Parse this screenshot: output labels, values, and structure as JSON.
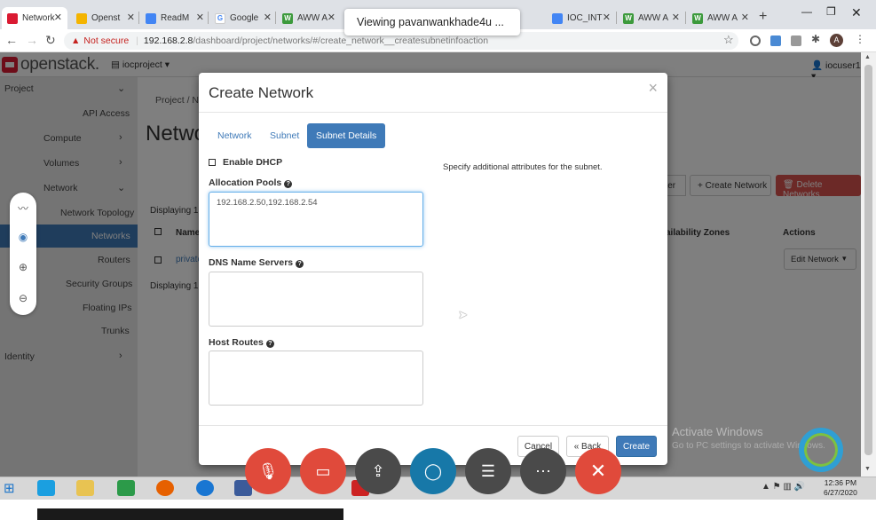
{
  "browser": {
    "tabs": [
      {
        "label": "Network",
        "icon": "openstack-favicon-icon",
        "color": "#da1a32",
        "active": true
      },
      {
        "label": "Openst",
        "icon": "drive-favicon-icon",
        "color": "#f4b400"
      },
      {
        "label": "ReadM",
        "icon": "docs-favicon-icon",
        "color": "#4285f4"
      },
      {
        "label": "Google",
        "icon": "google-favicon-icon",
        "color": "#4285f4"
      },
      {
        "label": "AWW A",
        "icon": "w-favicon-icon",
        "color": "#3c9a3c"
      },
      {
        "label": "IOC_INT",
        "icon": "docs-favicon-icon",
        "color": "#4285f4"
      },
      {
        "label": "AWW A",
        "icon": "w-favicon-icon",
        "color": "#3c9a3c"
      },
      {
        "label": "AWW A",
        "icon": "w-favicon-icon",
        "color": "#3c9a3c"
      }
    ],
    "address": {
      "warning": "Not secure",
      "host": "192.168.2.8",
      "path": "/dashboard/project/networks/#/create_network__createsubnetinfoaction"
    },
    "viewing_banner": "Viewing pavanwankhade4u ...",
    "profile_initial": "A"
  },
  "header": {
    "logo_text": "openstack.",
    "project": "iocproject",
    "user": "iocuser1"
  },
  "sidebar": {
    "project": "Project",
    "api_access": "API Access",
    "compute": "Compute",
    "volumes": "Volumes",
    "network": "Network",
    "network_topology": "Network Topology",
    "networks": "Networks",
    "routers": "Routers",
    "security_groups": "Security Groups",
    "floating_ips": "Floating IPs",
    "trunks": "Trunks",
    "identity": "Identity"
  },
  "page": {
    "breadcrumb": "Project / N",
    "title": "Netwo",
    "filter_btn": "ilter",
    "create_network_btn": "+ Create Network",
    "delete_networks_btn": "Delete Networks",
    "displaying_top": "Displaying 1",
    "displaying_bottom": "Displaying 1",
    "col_name": "Name",
    "col_zones": "ailability Zones",
    "col_actions": "Actions",
    "row_name": "private",
    "row_action": "Edit Network"
  },
  "modal": {
    "title": "Create Network",
    "close": "×",
    "tabs": [
      "Network",
      "Subnet",
      "Subnet Details"
    ],
    "enable_dhcp": "Enable DHCP",
    "allocation_pools_label": "Allocation Pools",
    "allocation_pools_value": "192.168.2.50,192.168.2.54",
    "dns_label": "DNS Name Servers",
    "host_routes_label": "Host Routes",
    "help_text": "Specify additional attributes for the subnet.",
    "cancel": "Cancel",
    "back": "« Back",
    "create": "Create"
  },
  "overlay": {
    "activate_title": "Activate Windows",
    "activate_sub": "Go to PC settings to activate Windows."
  },
  "call_controls": [
    "mute-mic-icon",
    "video-off-icon",
    "share-icon",
    "chat-icon",
    "notes-icon",
    "more-icon",
    "end-call-icon"
  ],
  "taskbar": {
    "time": "12:36 PM",
    "date": "6/27/2020"
  }
}
